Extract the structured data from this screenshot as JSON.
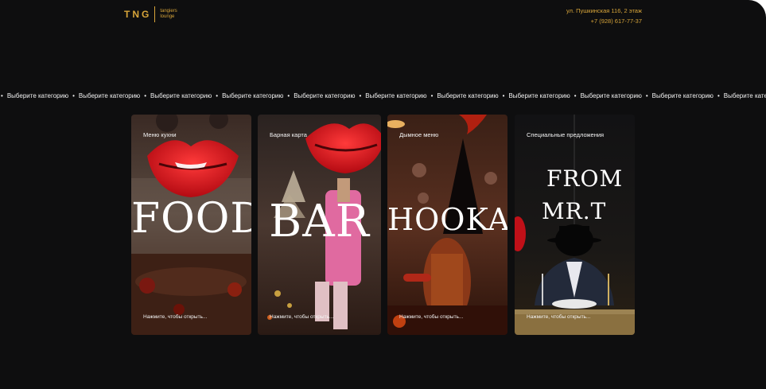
{
  "header": {
    "logo_mark": "TNG",
    "logo_sub_line1": "tangiers",
    "logo_sub_line2": "lounge",
    "address": "ул. Пушкинская 116, 2 этаж",
    "phone": "+7 (928) 617-77-37"
  },
  "ticker": {
    "text": "Выберите категорию",
    "separator": "•"
  },
  "cards": [
    {
      "label": "Меню кухни",
      "title": "FOOD",
      "hint": "Нажмите, чтобы открыть..."
    },
    {
      "label": "Барная карта",
      "title": "BAR",
      "hint": "Нажмите, чтобы открыть..."
    },
    {
      "label": "Дымное меню",
      "title": "HOOKAH",
      "hint": "Нажмите, чтобы открыть..."
    },
    {
      "label": "Специальные предложения",
      "title_line1": "FROM",
      "title_line2": "MR.T",
      "hint": "Нажмите, чтобы открыть..."
    }
  ],
  "colors": {
    "background": "#0e0e0f",
    "accent_gold": "#d8a53a",
    "lips_red": "#d3121c"
  }
}
